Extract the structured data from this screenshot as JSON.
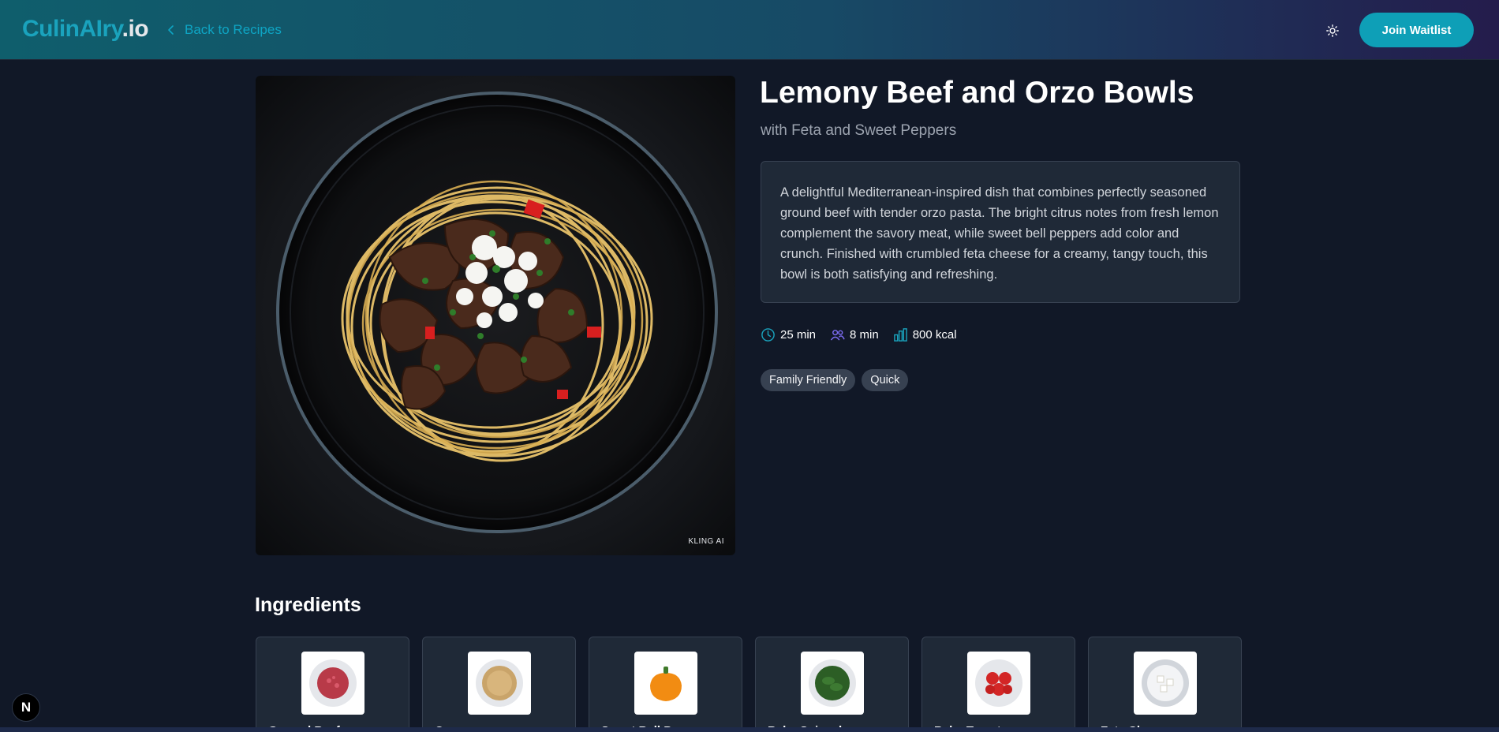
{
  "header": {
    "logo_main": "CulinAIry",
    "logo_suffix": ".io",
    "back_label": "Back to Recipes",
    "join_label": "Join Waitlist"
  },
  "recipe": {
    "title": "Lemony Beef and Orzo Bowls",
    "subtitle": "with Feta and Sweet Peppers",
    "description": "A delightful Mediterranean-inspired dish that combines perfectly seasoned ground beef with tender orzo pasta. The bright citrus notes from fresh lemon complement the savory meat, while sweet bell peppers add color and crunch. Finished with crumbled feta cheese for a creamy, tangy touch, this bowl is both satisfying and refreshing.",
    "image_watermark": "KLING AI",
    "stats": {
      "total_time": "25 min",
      "prep_time": "8 min",
      "calories": "800 kcal"
    },
    "tags": [
      "Family Friendly",
      "Quick"
    ]
  },
  "ingredients": {
    "title": "Ingredients",
    "items": [
      {
        "name": "Ground Beef",
        "icon": "ground-beef-icon"
      },
      {
        "name": "Orzo",
        "icon": "orzo-icon"
      },
      {
        "name": "Sweet Bell Pepper",
        "icon": "bell-pepper-icon"
      },
      {
        "name": "Baby Spinach",
        "icon": "spinach-icon"
      },
      {
        "name": "Baby Tomatoes",
        "icon": "tomatoes-icon"
      },
      {
        "name": "Feta Cheese",
        "icon": "feta-icon"
      }
    ]
  },
  "dev_badge": "N",
  "colors": {
    "accent": "#0e9fb7",
    "background": "#111827",
    "card": "#1f2937"
  }
}
